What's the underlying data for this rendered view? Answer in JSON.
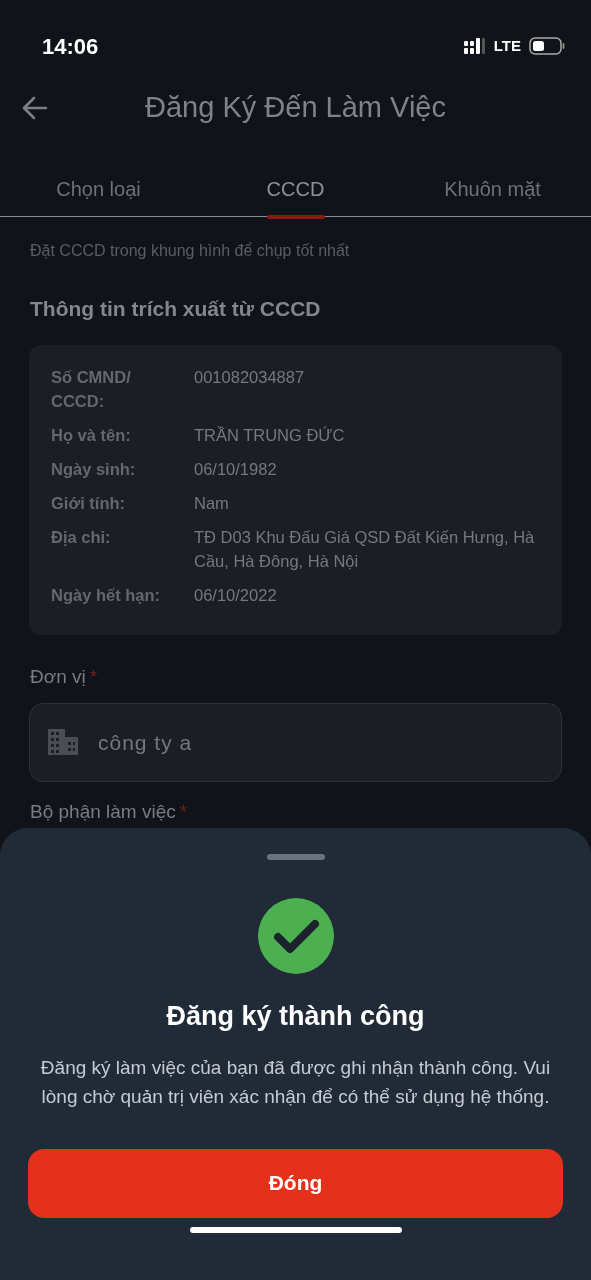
{
  "status_bar": {
    "time": "14:06",
    "network": "LTE"
  },
  "header": {
    "title": "Đăng Ký Đến Làm Việc"
  },
  "tabs": [
    {
      "label": "Chọn loại",
      "selected": false
    },
    {
      "label": "CCCD",
      "selected": true
    },
    {
      "label": "Khuôn mặt",
      "selected": false
    }
  ],
  "hint": "Đặt CCCD trong khung hình để chụp tốt nhất",
  "section_title": "Thông tin trích xuất từ CCCD",
  "id_info": [
    {
      "label": "Số CMND/ CCCD:",
      "value": "001082034887"
    },
    {
      "label": "Họ và tên:",
      "value": "TRẦN TRUNG ĐỨC"
    },
    {
      "label": "Ngày sinh:",
      "value": "06/10/1982"
    },
    {
      "label": "Giới tính:",
      "value": "Nam"
    },
    {
      "label": "Địa chỉ:",
      "value": "TĐ D03 Khu Đấu Giá QSD Đất Kiến Hưng, Hà Cầu, Hà Đông, Hà Nội"
    },
    {
      "label": "Ngày hết hạn:",
      "value": "06/10/2022"
    }
  ],
  "fields": [
    {
      "label": "Đơn vị",
      "required_mark": "*",
      "value": "công ty a"
    }
  ],
  "partial_label": {
    "label": "Bộ phận làm việc",
    "required_mark": "*"
  },
  "sheet": {
    "title": "Đăng ký thành công",
    "message": "Đăng ký làm việc của bạn đã được ghi nhận thành công. Vui lòng chờ quản trị viên xác nhận để có thể sử dụng hệ thống.",
    "button": "Đóng"
  }
}
